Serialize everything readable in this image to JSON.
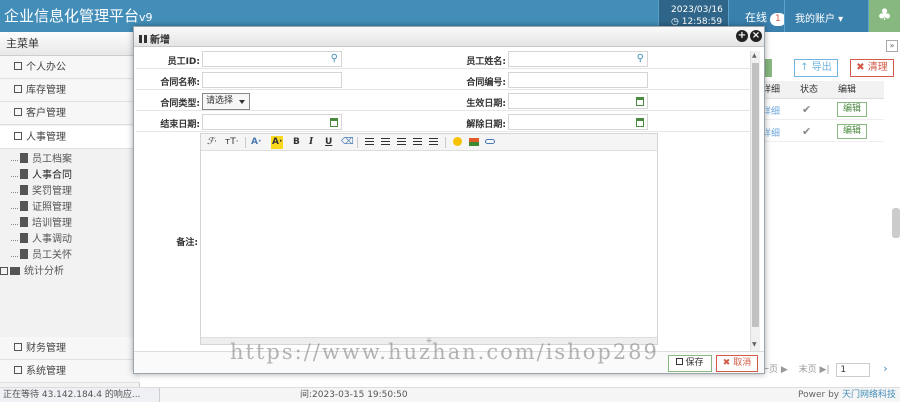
{
  "header": {
    "brand": "企业信息化管理平台",
    "version": "v9",
    "date": "2023/03/16",
    "time": "◷ 12:58:59",
    "online_label": "在线",
    "online_count": "1",
    "account_label": "我的账户 ▾",
    "tree_icon": "tree-icon"
  },
  "sidebar": {
    "title": "主菜单",
    "items": [
      {
        "label": "个人办公"
      },
      {
        "label": "库存管理"
      },
      {
        "label": "客户管理"
      },
      {
        "label": "人事管理"
      }
    ],
    "tree": [
      {
        "label": "员工档案"
      },
      {
        "label": "人事合同"
      },
      {
        "label": "奖罚管理"
      },
      {
        "label": "证照管理"
      },
      {
        "label": "培训管理"
      },
      {
        "label": "人事调动"
      },
      {
        "label": "员工关怀"
      }
    ],
    "folder": "统计分析",
    "bottom_items": [
      {
        "label": "财务管理"
      },
      {
        "label": "系统管理"
      }
    ]
  },
  "background": {
    "export_label": "↑ 导出",
    "clear_label": "✖ 清理",
    "col_detail": "详细",
    "col_status": "状态",
    "col_edit": "编辑",
    "rows": [
      {
        "detail": "详细",
        "edit": "编辑"
      },
      {
        "detail": "详细",
        "edit": "编辑"
      }
    ],
    "pager_prev": "一页 ▶",
    "pager_last": "末页 ▶|",
    "pager_page": "1",
    "pager_next": "›",
    "expand": "»"
  },
  "dialog": {
    "title": "新增",
    "fields": {
      "emp_id_label": "员工ID:",
      "emp_name_label": "员工姓名:",
      "contract_name_label": "合同名称:",
      "contract_no_label": "合同编号:",
      "contract_type_label": "合同类型:",
      "contract_type_value": "请选择",
      "effective_date_label": "生效日期:",
      "end_date_label": "结束日期:",
      "termination_date_label": "解除日期:",
      "remarks_label": "备注:"
    },
    "toolbar": {
      "font": "ℱ·",
      "size": "ᴛT·",
      "font_color": "A·",
      "highlight": "A·",
      "bold": "B",
      "italic": "I",
      "underline": "U",
      "eraser": "⌫"
    },
    "save_label": "保存",
    "cancel_label": "✖ 取消",
    "grip": "⁜"
  },
  "footer": {
    "status": "正在等待 43.142.184.4 的响应...",
    "time": "间:2023-03-15 19:50:50",
    "power_prefix": "Power by ",
    "power_name": "天门网络科技"
  },
  "watermark": "https://www.huzhan.com/ishop289",
  "colors": {
    "brand_blue": "#438eb9",
    "green": "#87b87f",
    "red": "#d15b47"
  }
}
